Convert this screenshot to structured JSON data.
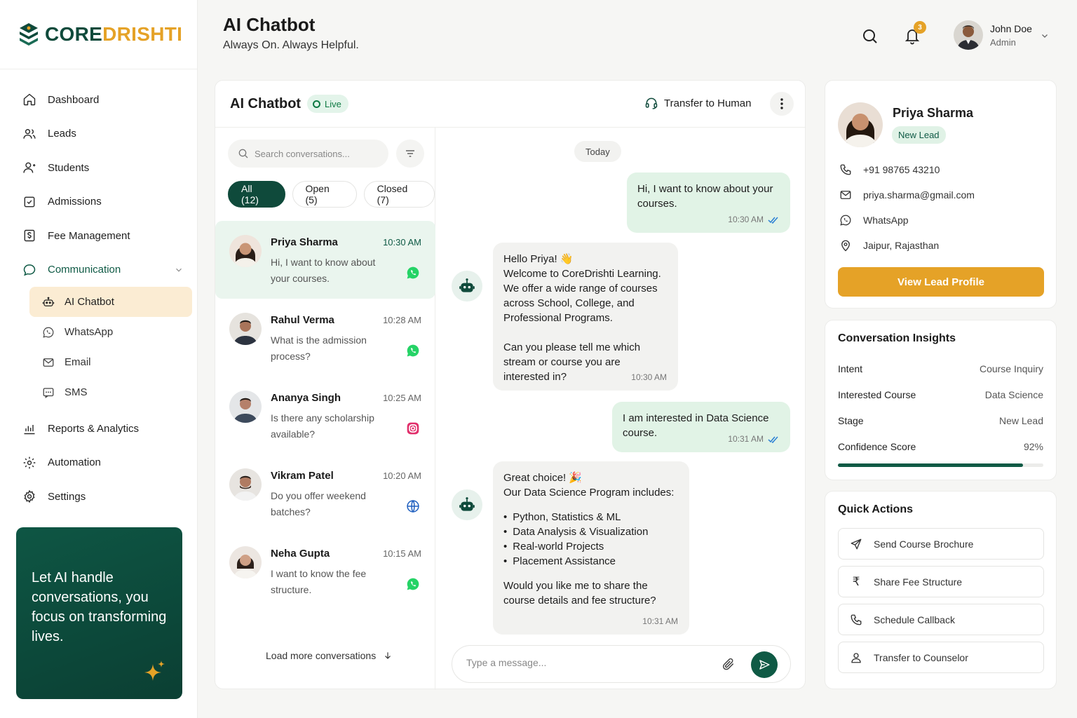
{
  "brand": {
    "part1": "CORE",
    "part2": "DRISHTI",
    "accent": "#e5a227",
    "primary": "#0f4a3b"
  },
  "nav": {
    "items": [
      {
        "label": "Dashboard",
        "icon": "home-icon"
      },
      {
        "label": "Leads",
        "icon": "users-icon"
      },
      {
        "label": "Students",
        "icon": "student-icon"
      },
      {
        "label": "Admissions",
        "icon": "checkbox-icon"
      },
      {
        "label": "Fee Management",
        "icon": "fee-icon"
      },
      {
        "label": "Communication",
        "icon": "chat-bubble-icon"
      }
    ],
    "sub": [
      {
        "label": "AI Chatbot",
        "icon": "robot-icon"
      },
      {
        "label": "WhatsApp",
        "icon": "whatsapp-icon"
      },
      {
        "label": "Email",
        "icon": "mail-icon"
      },
      {
        "label": "SMS",
        "icon": "sms-icon"
      }
    ],
    "bottom": [
      {
        "label": "Reports & Analytics",
        "icon": "chart-icon"
      },
      {
        "label": "Automation",
        "icon": "automation-icon"
      },
      {
        "label": "Settings",
        "icon": "gear-icon"
      }
    ]
  },
  "promo": {
    "text": "Let AI handle conversations, you focus on transforming lives."
  },
  "header": {
    "title": "AI Chatbot",
    "subtitle": "Always On. Always Helpful.",
    "notification_count": "3"
  },
  "user": {
    "name": "John Doe",
    "role": "Admin"
  },
  "chat": {
    "title": "AI Chatbot",
    "status": "Live",
    "transfer_label": "Transfer to Human",
    "search_placeholder": "Search conversations...",
    "tabs": [
      "All (12)",
      "Open (5)",
      "Closed (7)"
    ],
    "load_more": "Load more conversations",
    "conversations": [
      {
        "name": "Priya Sharma",
        "time": "10:30 AM",
        "message": "Hi, I want to know about your courses.",
        "channel": "whatsapp"
      },
      {
        "name": "Rahul Verma",
        "time": "10:28 AM",
        "message": "What is the admission process?",
        "channel": "whatsapp"
      },
      {
        "name": "Ananya Singh",
        "time": "10:25 AM",
        "message": "Is there any scholarship available?",
        "channel": "instagram"
      },
      {
        "name": "Vikram Patel",
        "time": "10:20 AM",
        "message": "Do you offer weekend batches?",
        "channel": "web"
      },
      {
        "name": "Neha Gupta",
        "time": "10:15 AM",
        "message": "I want to know the fee structure.",
        "channel": "whatsapp"
      }
    ],
    "day_label": "Today",
    "messages": {
      "m1": {
        "text": "Hi, I want to know about your courses.",
        "time": "10:30 AM"
      },
      "m2": {
        "greeting": "Hello Priya! 👋",
        "body": "Welcome to CoreDrishti Learning. We offer a wide range of courses across School, College, and Professional Programs.",
        "question": "Can you please tell me which stream or course you are interested in?",
        "time": "10:30 AM"
      },
      "m3": {
        "text": "I am interested in Data Science course.",
        "time": "10:31 AM"
      },
      "m4": {
        "greeting": "Great choice! 🎉",
        "intro": "Our Data Science Program includes:",
        "bullets": [
          "Python, Statistics & ML",
          "Data Analysis & Visualization",
          "Real-world Projects",
          "Placement Assistance"
        ],
        "question": "Would you like me to share the course details and fee structure?",
        "time": "10:31 AM"
      }
    },
    "composer_placeholder": "Type a message..."
  },
  "lead": {
    "name": "Priya Sharma",
    "badge": "New Lead",
    "phone": "+91 98765 43210",
    "email": "priya.sharma@gmail.com",
    "channel": "WhatsApp",
    "location": "Jaipur, Rajasthan",
    "button": "View Lead Profile"
  },
  "insights": {
    "title": "Conversation Insights",
    "rows": [
      {
        "k": "Intent",
        "v": "Course Inquiry"
      },
      {
        "k": "Interested Course",
        "v": "Data Science"
      },
      {
        "k": "Stage",
        "v": "New Lead"
      },
      {
        "k": "Confidence Score",
        "v": "92%"
      }
    ],
    "confidence": 0.9
  },
  "quick_actions": {
    "title": "Quick Actions",
    "items": [
      "Send Course Brochure",
      "Share Fee Structure",
      "Schedule Callback",
      "Transfer to Counselor"
    ]
  }
}
